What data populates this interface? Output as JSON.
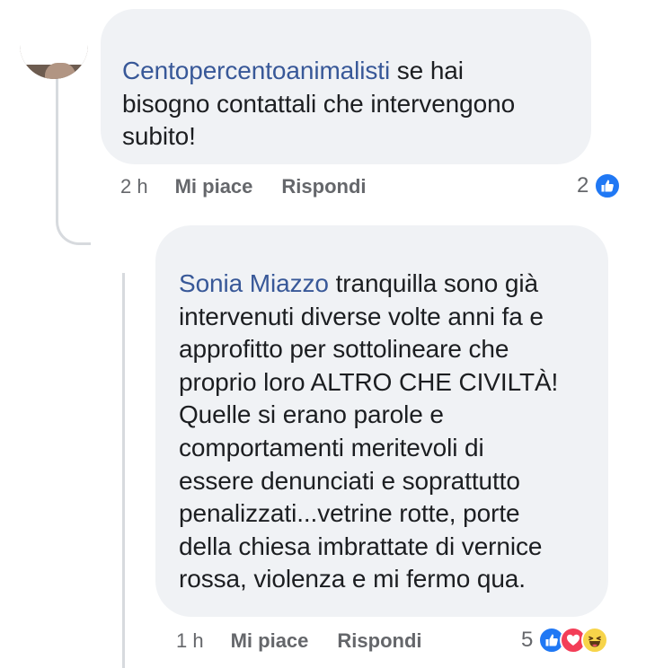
{
  "comments": [
    {
      "author": "Centopercentoanimalisti",
      "lines": [
        " se hai",
        "bisogno contattali che intervengono",
        "subito!"
      ],
      "time": "2 h",
      "like_label": "Mi piace",
      "reply_label": "Rispondi",
      "reaction_count": "2",
      "reactions": [
        "like-icon"
      ]
    },
    {
      "author": "Sonia Miazzo",
      "lines": [
        " tranquilla sono già",
        "intervenuti diverse volte anni fa e",
        "approfitto per sottolineare che",
        "proprio loro ALTRO CHE CIVILTÀ!",
        "Quelle si erano parole e",
        "comportamenti meritevoli di",
        "essere denunciati e soprattutto",
        "penalizzati...vetrine rotte, porte",
        "della chiesa imbrattate di vernice",
        "rossa, violenza e mi fermo qua."
      ],
      "time": "1 h",
      "like_label": "Mi piace",
      "reply_label": "Rispondi",
      "reaction_count": "5",
      "reactions": [
        "like-icon",
        "love-icon",
        "haha-icon"
      ]
    }
  ],
  "colors": {
    "bubble": "#f0f2f5",
    "author": "#385898",
    "meta": "#65676b",
    "like": "#2078f4",
    "love": "#f33e58",
    "haha": "#f7d44a"
  }
}
